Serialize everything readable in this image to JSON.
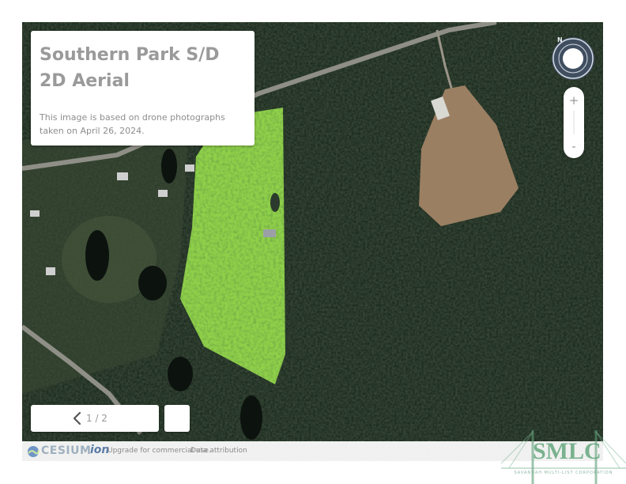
{
  "info_card": {
    "title": "Southern Park S/D\n2D Aerial",
    "description": "This image is based on drone photographs taken on April 26, 2024."
  },
  "compass": {
    "north_label": "N"
  },
  "zoom": {
    "in_label": "+",
    "out_label": "-"
  },
  "pager": {
    "text": "1 / 2"
  },
  "credits": {
    "cesium_label": "CESIUM",
    "ion_label": "ion",
    "upgrade_text": "Upgrade for commercial use.",
    "attribution_text": "Data attribution"
  },
  "watermark": {
    "logo_text": "SMLC",
    "subtitle": "SAVANNAH MULTI-LIST CORPORATION"
  },
  "colors": {
    "forest": "#1f2e21",
    "highlight_parcel": "#8fd04a",
    "cleared_field": "#9b7f62",
    "road": "#8f8f87",
    "card_text": "#9a9a9a"
  }
}
